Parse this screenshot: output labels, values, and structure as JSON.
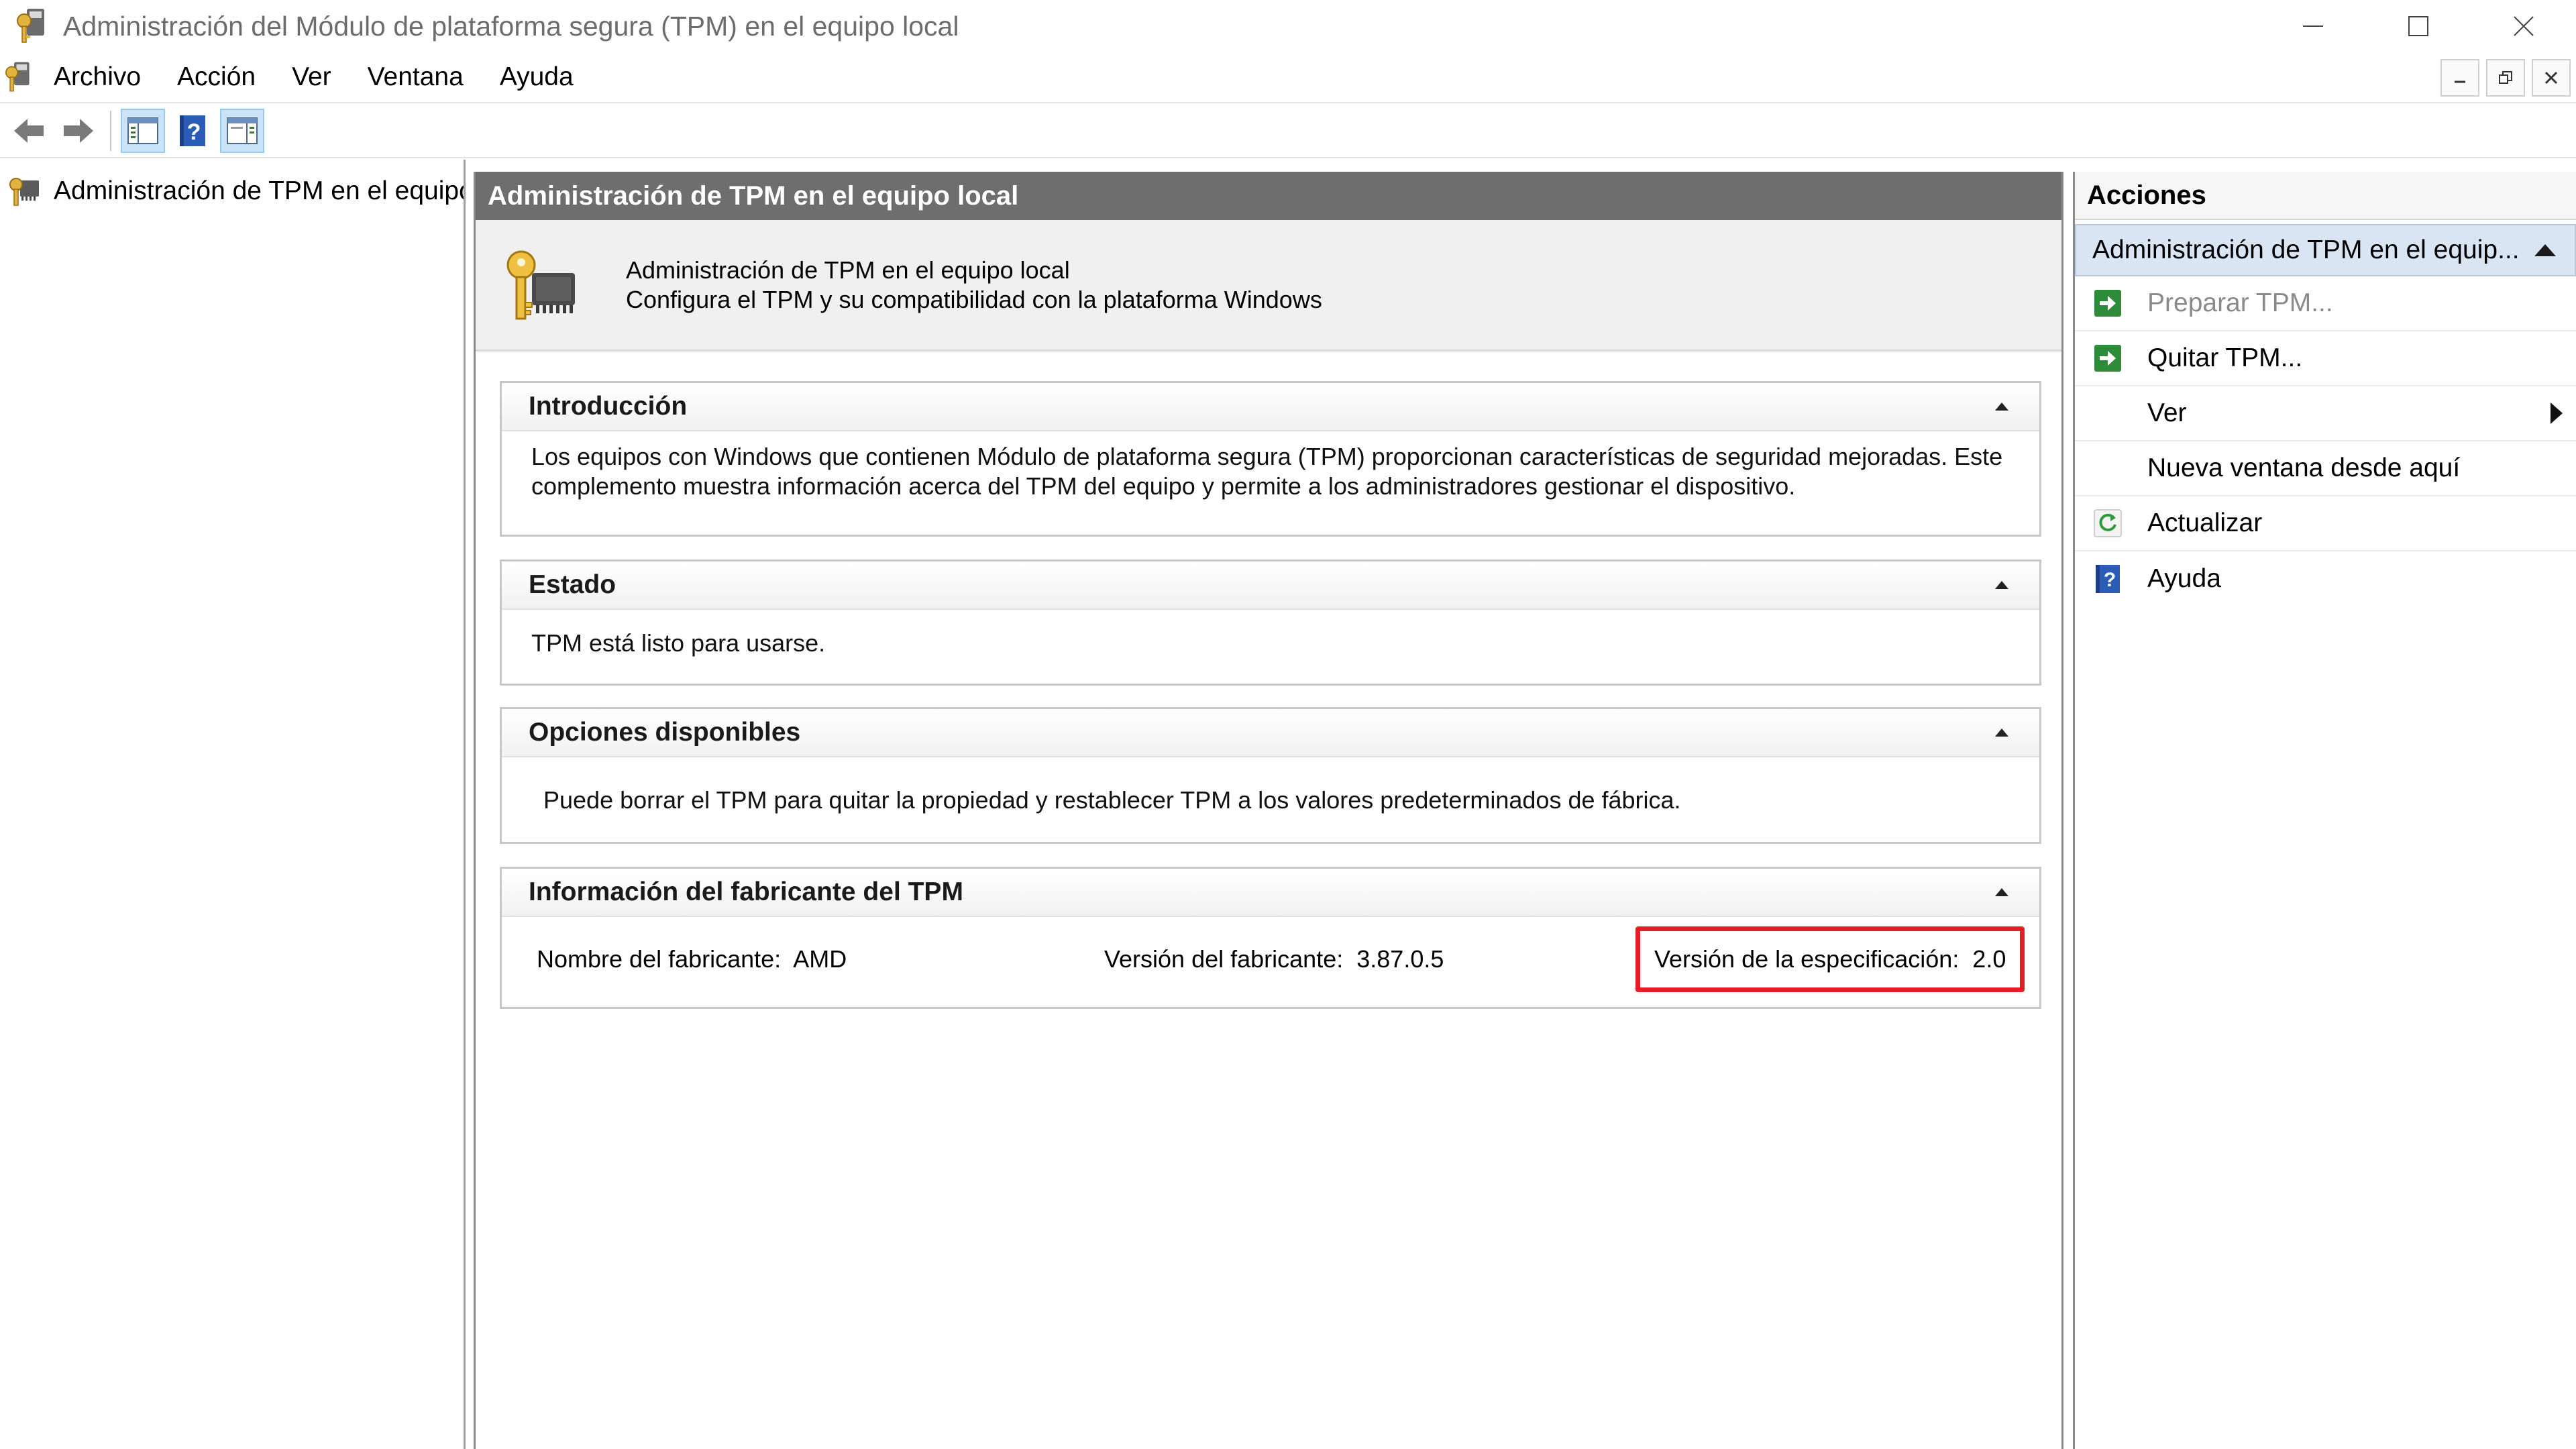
{
  "window": {
    "title": "Administración del Módulo de plataforma segura (TPM) en el equipo local",
    "app_icon": "tpm-key-icon"
  },
  "menu": {
    "items": [
      "Archivo",
      "Acción",
      "Ver",
      "Ventana",
      "Ayuda"
    ]
  },
  "toolbar": {
    "buttons": [
      "back-arrow-icon",
      "forward-arrow-icon",
      "show-hide-console-tree-icon",
      "help-icon",
      "show-hide-action-pane-icon"
    ]
  },
  "tree": {
    "root_label": "Administración de TPM en el equipo local"
  },
  "center": {
    "header": "Administración de TPM en el equipo local",
    "intro_title": "Administración de TPM en el equipo local",
    "intro_subtitle": "Configura el TPM y su compatibilidad con la plataforma Windows",
    "sections": {
      "intro": {
        "title": "Introducción",
        "body": "Los equipos con Windows que contienen Módulo de plataforma segura (TPM) proporcionan características de seguridad mejoradas. Este complemento muestra información acerca del TPM del equipo y permite a los administradores gestionar el dispositivo."
      },
      "status": {
        "title": "Estado",
        "body": "TPM está listo para usarse."
      },
      "options": {
        "title": "Opciones disponibles",
        "body": "Puede borrar el TPM para quitar la propiedad y restablecer TPM a los valores predeterminados de fábrica."
      },
      "vendor": {
        "title": "Información del fabricante del TPM",
        "manufacturer_label": "Nombre del fabricante:",
        "manufacturer_value": "AMD",
        "version_label": "Versión del fabricante:",
        "version_value": "3.87.0.5",
        "spec_label": "Versión de la especificación:",
        "spec_value": "2.0"
      }
    }
  },
  "actions": {
    "title": "Acciones",
    "group": "Administración de TPM en el equip...",
    "items": [
      {
        "label": "Preparar TPM...",
        "icon": "green-arrow-icon",
        "enabled": false
      },
      {
        "label": "Quitar TPM...",
        "icon": "green-arrow-icon",
        "enabled": true
      },
      {
        "label": "Ver",
        "icon": "",
        "submenu": true
      },
      {
        "label": "Nueva ventana desde aquí",
        "icon": ""
      },
      {
        "label": "Actualizar",
        "icon": "refresh-icon"
      },
      {
        "label": "Ayuda",
        "icon": "help-icon"
      }
    ]
  },
  "colors": {
    "highlight": "#e41e26",
    "center_header_bg": "#6e6e6e",
    "actions_group_bg": "#d9e5f3"
  }
}
